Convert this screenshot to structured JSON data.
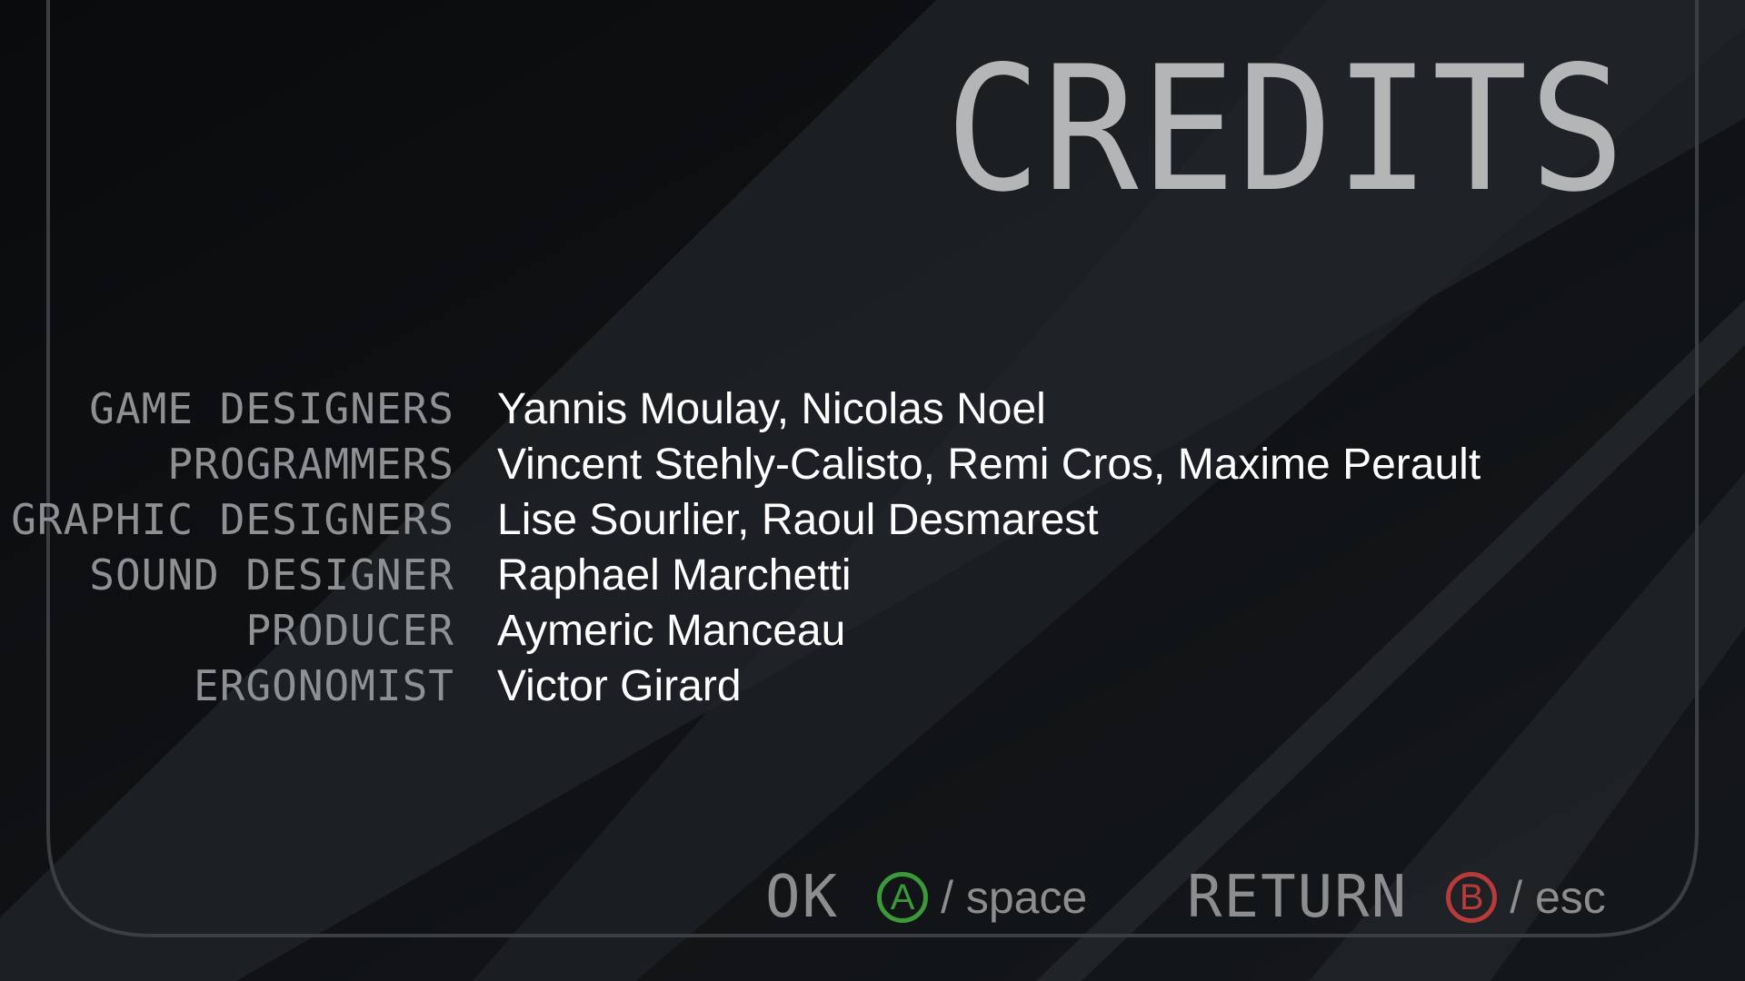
{
  "title": "CREDITS",
  "credits": [
    {
      "role": "GAME DESIGNERS",
      "names": "Yannis Moulay, Nicolas Noel"
    },
    {
      "role": "PROGRAMMERS",
      "names": "Vincent Stehly-Calisto, Remi Cros, Maxime Perault"
    },
    {
      "role": "GRAPHIC DESIGNERS",
      "names": "Lise Sourlier, Raoul Desmarest"
    },
    {
      "role": "SOUND DESIGNER",
      "names": "Raphael Marchetti"
    },
    {
      "role": "PRODUCER",
      "names": "Aymeric Manceau"
    },
    {
      "role": "ERGONOMIST",
      "names": "Victor Girard"
    }
  ],
  "controls": {
    "ok": {
      "label": "OK",
      "button": "A",
      "key": "/ space",
      "button_icon": "a-button-icon",
      "color": "#3a9a3a"
    },
    "return": {
      "label": "RETURN",
      "button": "B",
      "key": "/ esc",
      "button_icon": "b-button-icon",
      "color": "#b83a3a"
    }
  },
  "colors": {
    "background": "#0f1113",
    "title": "#b3b5b7",
    "role_text": "#8e9194",
    "name_text": "#ffffff"
  }
}
